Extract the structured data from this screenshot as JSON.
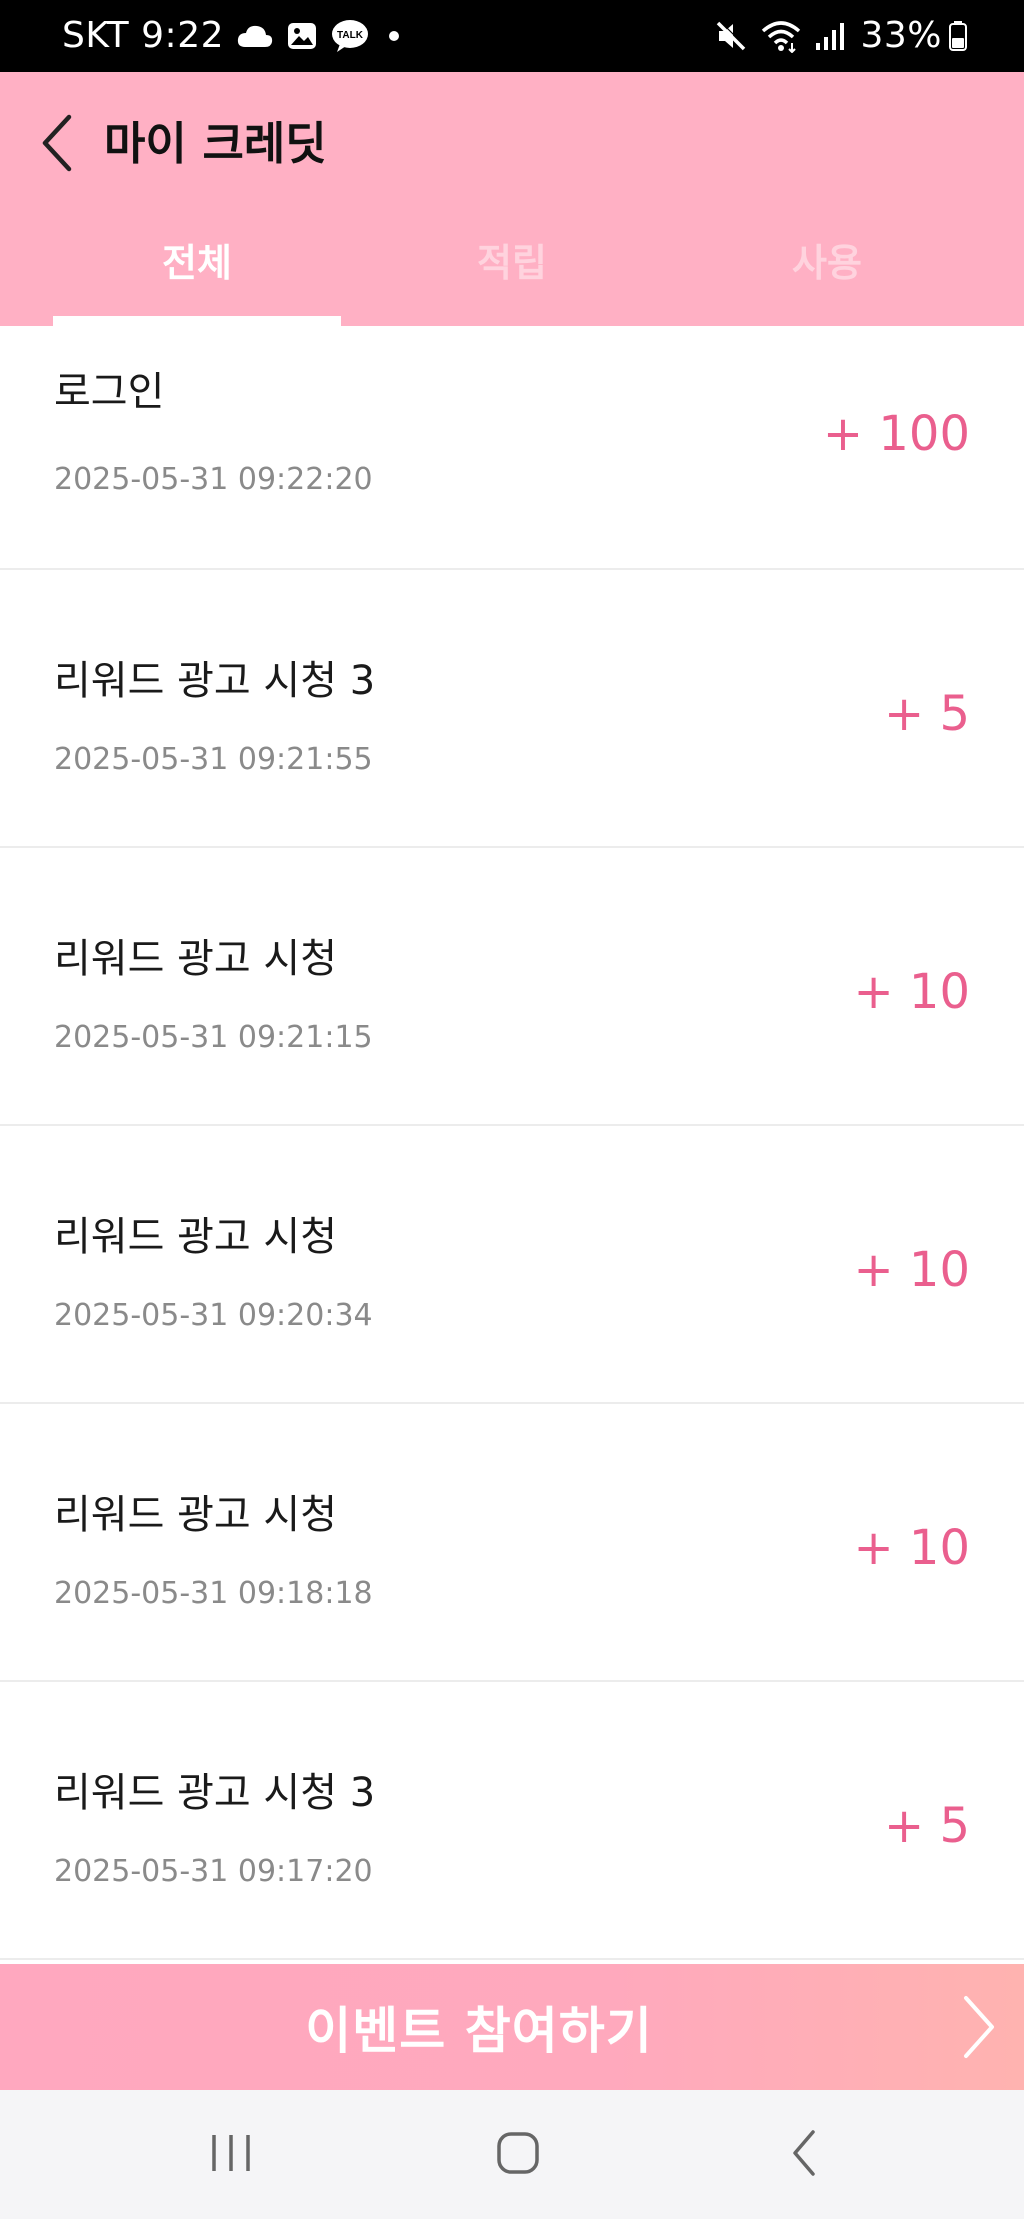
{
  "status_bar": {
    "carrier": "SKT",
    "time": "9:22",
    "battery": "33%",
    "left_icons": [
      "cloud-icon",
      "gallery-icon",
      "kakaotalk-icon",
      "dot-icon"
    ],
    "kakaotalk_badge": "TALK",
    "right_icons": [
      "mute-icon",
      "wifi-icon",
      "signal-icon",
      "battery-icon"
    ]
  },
  "header": {
    "back_icon": "chevron-left-icon",
    "title": "마이 크레딧",
    "background": "#ffb0c4"
  },
  "tabs": [
    {
      "label": "전체",
      "active": true
    },
    {
      "label": "적립",
      "active": false
    },
    {
      "label": "사용",
      "active": false
    }
  ],
  "transactions": [
    {
      "title": "로그인",
      "date": "2025-05-31 09:22:20",
      "amount": "+ 100"
    },
    {
      "title": "리워드 광고 시청 3",
      "date": "2025-05-31 09:21:55",
      "amount": "+ 5"
    },
    {
      "title": "리워드 광고 시청",
      "date": "2025-05-31 09:21:15",
      "amount": "+ 10"
    },
    {
      "title": "리워드 광고 시청",
      "date": "2025-05-31 09:20:34",
      "amount": "+ 10"
    },
    {
      "title": "리워드 광고 시청",
      "date": "2025-05-31 09:18:18",
      "amount": "+ 10"
    },
    {
      "title": "리워드 광고 시청 3",
      "date": "2025-05-31 09:17:20",
      "amount": "+ 5"
    }
  ],
  "event_bar": {
    "label": "이벤트 참여하기",
    "icon": "chevron-right-icon"
  },
  "nav_bar": {
    "buttons": [
      "recent-apps-icon",
      "home-icon",
      "back-icon"
    ]
  },
  "colors": {
    "accent": "#ea5f8e",
    "header_pink": "#ffb0c4",
    "inactive_tab": "#ffd3de"
  }
}
